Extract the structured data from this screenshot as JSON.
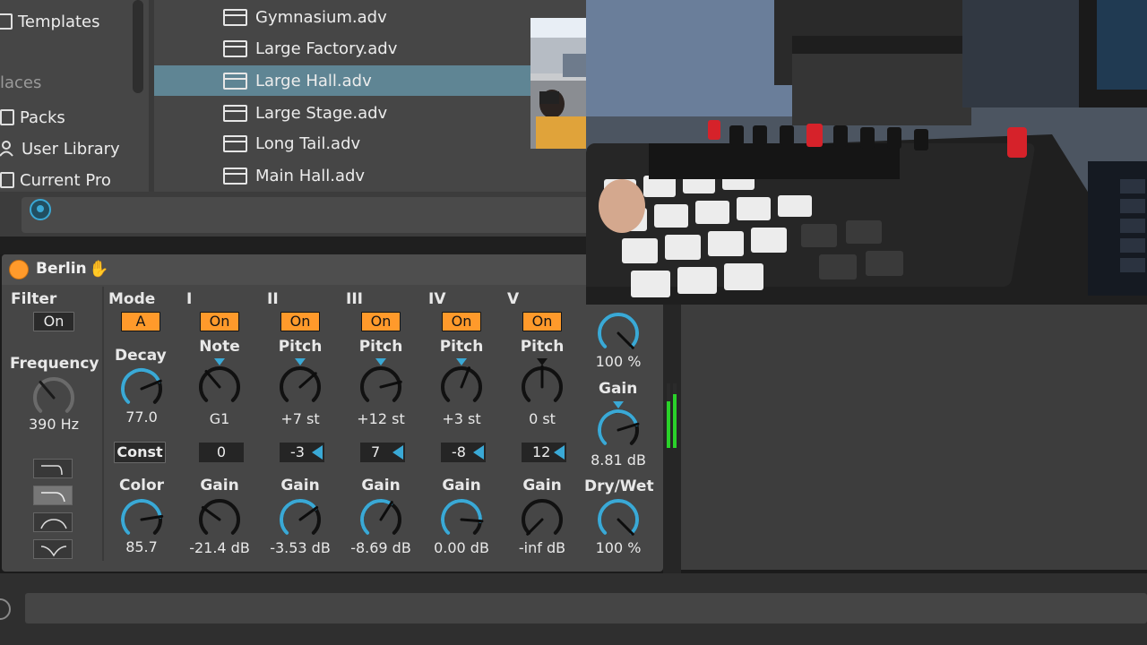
{
  "browser": {
    "places": [
      {
        "label": "Templates",
        "icon": "template-icon"
      },
      {
        "label": "laces",
        "icon": ""
      },
      {
        "label": "Packs",
        "icon": "packs-icon"
      },
      {
        "label": "User Library",
        "icon": "user-library-icon"
      },
      {
        "label": "Current Pro",
        "icon": "current-project-icon"
      }
    ],
    "files": [
      {
        "label": "Gymnasium.adv",
        "selected": false
      },
      {
        "label": "Large Factory.adv",
        "selected": false
      },
      {
        "label": "Large Hall.adv",
        "selected": true
      },
      {
        "label": "Large Stage.adv",
        "selected": false
      },
      {
        "label": "Long Tail.adv",
        "selected": false
      },
      {
        "label": "Main Hall.adv",
        "selected": false
      }
    ]
  },
  "device": {
    "title": "Berlin",
    "filter": {
      "label": "Filter",
      "toggle": "On",
      "freq_label": "Frequency",
      "freq_value": "390 Hz",
      "freq_level": 0.35
    },
    "mode": {
      "label": "Mode",
      "button": "A",
      "decay_label": "Decay",
      "decay_value": "77.0",
      "decay_level": 0.75,
      "const_label": "Const",
      "color_label": "Color",
      "color_value": "85.7",
      "color_level": 0.8
    },
    "columns": [
      {
        "roman": "I",
        "toggle": "On",
        "param": "Note",
        "param_value": "G1",
        "param_level": 0.35,
        "offset": "0",
        "offset_arrow": false,
        "gain_label": "Gain",
        "gain_value": "-21.4 dB",
        "gain_level": 0.3
      },
      {
        "roman": "II",
        "toggle": "On",
        "param": "Pitch",
        "param_value": "+7 st",
        "param_level": 0.68,
        "offset": "-3",
        "offset_arrow": true,
        "gain_label": "Gain",
        "gain_value": "-3.53 dB",
        "gain_level": 0.7
      },
      {
        "roman": "III",
        "toggle": "On",
        "param": "Pitch",
        "param_value": "+12 st",
        "param_level": 0.78,
        "offset": "7",
        "offset_arrow": true,
        "gain_label": "Gain",
        "gain_value": "-8.69 dB",
        "gain_level": 0.62
      },
      {
        "roman": "IV",
        "toggle": "On",
        "param": "Pitch",
        "param_value": "+3 st",
        "param_level": 0.58,
        "offset": "-8",
        "offset_arrow": true,
        "gain_label": "Gain",
        "gain_value": "0.00 dB",
        "gain_level": 0.85
      },
      {
        "roman": "V",
        "toggle": "On",
        "param": "Pitch",
        "param_value": "0 st",
        "param_level": 0.5,
        "offset": "12",
        "offset_arrow": true,
        "gain_label": "Gain",
        "gain_value": "-inf dB",
        "gain_level": 0.0
      }
    ],
    "output": {
      "top_value": "100 %",
      "top_level": 1.0,
      "gain_label": "Gain",
      "gain_value": "8.81 dB",
      "gain_level": 0.77,
      "drywet_label": "Dry/Wet",
      "drywet_value": "100 %",
      "drywet_level": 1.0
    },
    "filter_shapes": [
      "lowpass-shape-icon",
      "lowpass-soft-shape-icon",
      "bandpass-shape-icon",
      "notch-shape-icon"
    ],
    "active_shape": 1
  },
  "colors": {
    "accent_orange": "#ff9a2b",
    "accent_blue": "#3aa9d6",
    "panel": "#464646",
    "selection": "#5f8594",
    "meter_green": "#2ad12a"
  }
}
